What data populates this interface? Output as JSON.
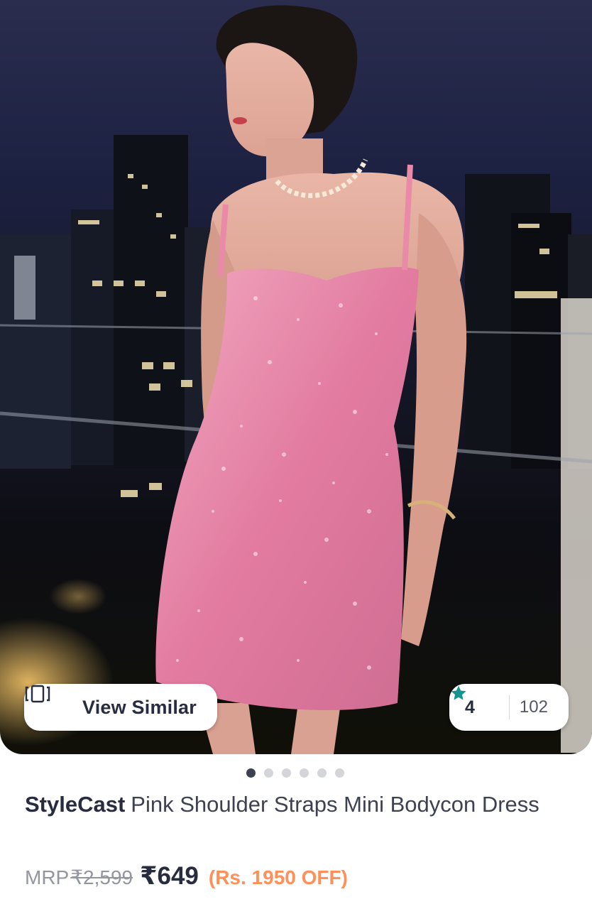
{
  "product_image": {
    "alt_icon": "product-photo",
    "view_similar_label": "View Similar",
    "view_similar_icon": "view-similar-icon",
    "rating": {
      "value": "4",
      "icon": "star-icon",
      "star_color": "#14958f",
      "count": "102"
    }
  },
  "carousel": {
    "total": 6,
    "active_index": 0
  },
  "product": {
    "brand": "StyleCast",
    "name": "Pink Shoulder Straps Mini Bodycon Dress",
    "mrp_label": "MRP",
    "mrp_value": "₹2,599",
    "price": "₹649",
    "discount": "(Rs. 1950 OFF)"
  },
  "colors": {
    "text_primary": "#282c3f",
    "discount": "#ff905a",
    "muted": "#94969f",
    "dress": "#e98aa8"
  }
}
